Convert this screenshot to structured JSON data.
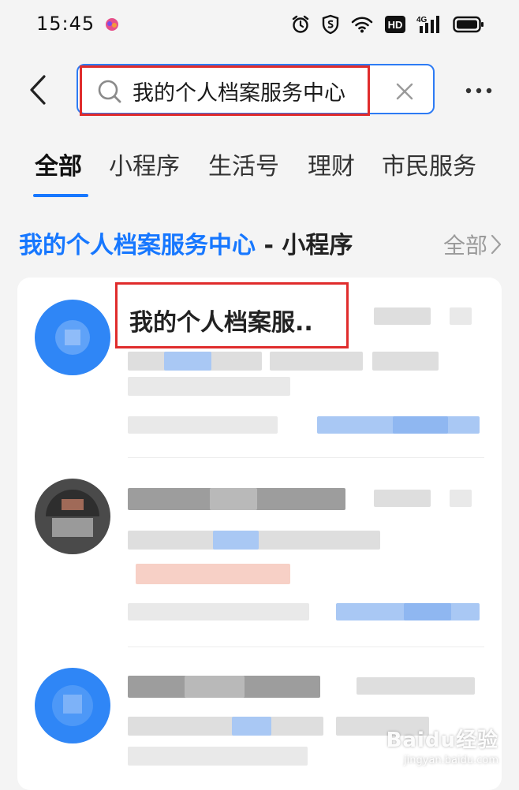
{
  "status_bar": {
    "time": "15:45",
    "network_label": "4G",
    "hd_label": "HD"
  },
  "search": {
    "query": "我的个人档案服务中心"
  },
  "tabs": [
    {
      "label": "全部",
      "active": true
    },
    {
      "label": "小程序",
      "active": false
    },
    {
      "label": "生活号",
      "active": false
    },
    {
      "label": "理财",
      "active": false
    },
    {
      "label": "市民服务",
      "active": false
    }
  ],
  "section": {
    "query_part": "我的个人档案服务中心",
    "type_part": " - 小程序",
    "all_label": "全部"
  },
  "results": [
    {
      "title": "我的个人档案服..",
      "avatar_color": "#2f86f6"
    },
    {
      "title": "",
      "avatar_color": "#4a4a4a"
    },
    {
      "title": "",
      "avatar_color": "#2f86f6"
    }
  ],
  "watermark": {
    "main": "Baidu经验",
    "sub": "jingyan.baidu.com"
  },
  "colors": {
    "accent": "#1677ff",
    "highlight_box": "#e02c2c",
    "background": "#f4f4f4"
  }
}
